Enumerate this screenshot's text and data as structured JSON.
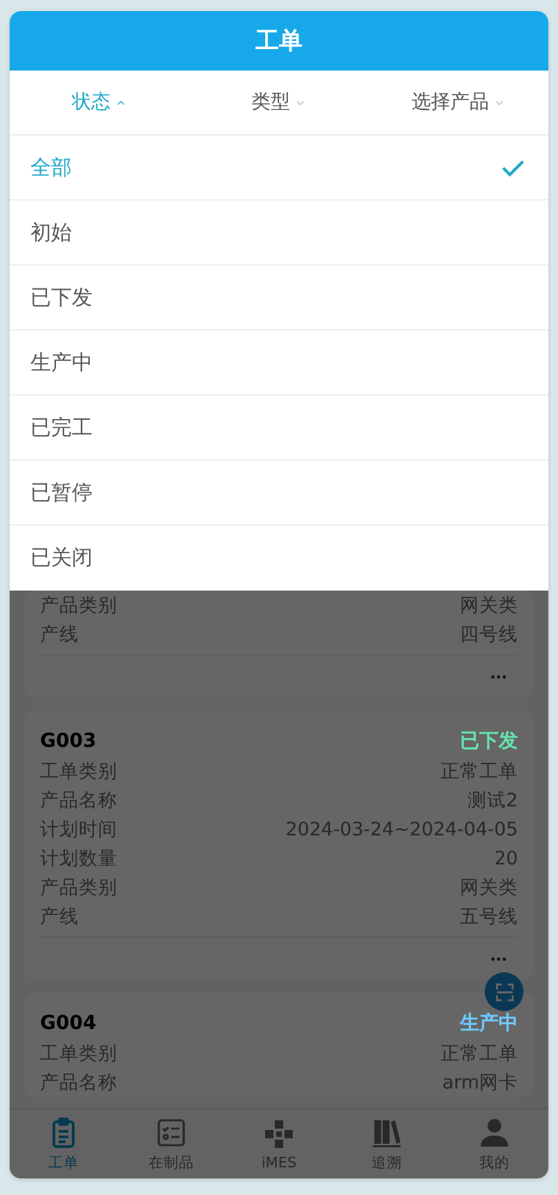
{
  "header": {
    "title": "工单"
  },
  "filters": [
    {
      "label": "状态",
      "selected": true
    },
    {
      "label": "类型",
      "selected": false
    },
    {
      "label": "选择产品",
      "selected": false
    }
  ],
  "status_options": [
    {
      "label": "全部",
      "selected": true
    },
    {
      "label": "初始",
      "selected": false
    },
    {
      "label": "已下发",
      "selected": false
    },
    {
      "label": "生产中",
      "selected": false
    },
    {
      "label": "已完工",
      "selected": false
    },
    {
      "label": "已暂停",
      "selected": false
    },
    {
      "label": "已关闭",
      "selected": false
    }
  ],
  "work_orders": [
    {
      "more_menu": true,
      "fields": [
        {
          "label": "产品类别",
          "value": "网关类"
        },
        {
          "label": "产线",
          "value": "四号线"
        }
      ]
    },
    {
      "code": "G003",
      "status": "已下发",
      "color": "#66e3ad",
      "more_menu": true,
      "fields": [
        {
          "label": "工单类别",
          "value": "正常工单"
        },
        {
          "label": "产品名称",
          "value": "测试2"
        },
        {
          "label": "计划时间",
          "value": "2024-03-24~2024-04-05"
        },
        {
          "label": "计划数量",
          "value": "20"
        },
        {
          "label": "产品类别",
          "value": "网关类"
        },
        {
          "label": "产线",
          "value": "五号线"
        }
      ]
    },
    {
      "code": "G004",
      "status": "生产中",
      "color": "#6ccaff",
      "fields": [
        {
          "label": "工单类别",
          "value": "正常工单"
        },
        {
          "label": "产品名称",
          "value": "arm网卡"
        }
      ]
    }
  ],
  "tab_bar": [
    {
      "label": "工单",
      "kind": "clipboard",
      "selected": true
    },
    {
      "label": "在制品",
      "kind": "checklist",
      "selected": false
    },
    {
      "label": "iMES",
      "kind": "blocks",
      "selected": false
    },
    {
      "label": "追溯",
      "kind": "books",
      "selected": false
    },
    {
      "label": "我的",
      "kind": "person",
      "selected": false
    }
  ]
}
